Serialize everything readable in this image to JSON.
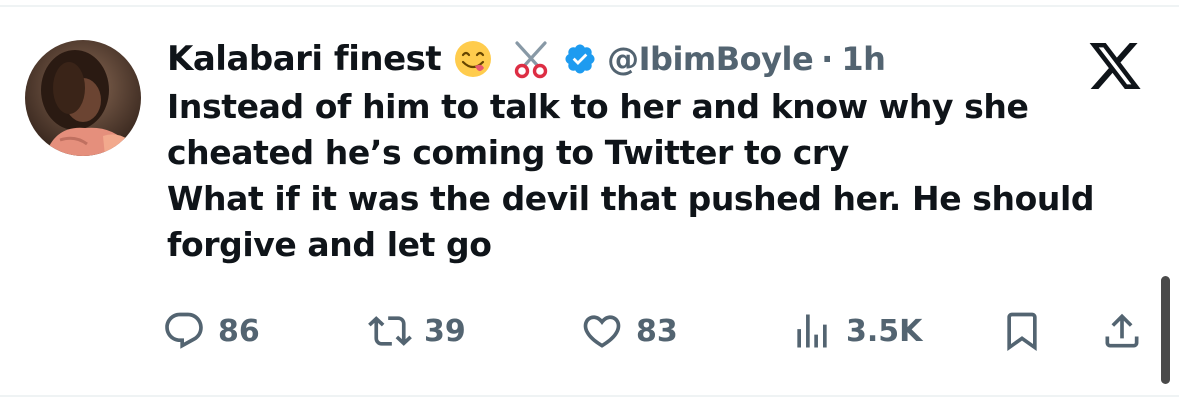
{
  "tweet": {
    "display_name": "Kalabari finest",
    "name_emojis": [
      "face-savoring-food-emoji",
      "scissors-emoji"
    ],
    "verified": true,
    "handle": "@IbimBoyle",
    "separator": "·",
    "timestamp": "1h",
    "text_lines": [
      "Instead of him to talk to her and know why she cheated he’s coming to Twitter to cry",
      "What if it was the devil that pushed her. He should forgive and let go"
    ]
  },
  "actions": {
    "replies": "86",
    "reposts": "39",
    "likes": "83",
    "views": "3.5K"
  },
  "icons": {
    "reply": "reply-icon",
    "repost": "repost-icon",
    "like": "heart-icon",
    "views": "views-icon",
    "bookmark": "bookmark-icon",
    "share": "share-icon",
    "brand": "x-logo-icon"
  },
  "colors": {
    "text": "#0f1419",
    "secondary": "#536471",
    "verified_blue": "#1d9bf0"
  }
}
